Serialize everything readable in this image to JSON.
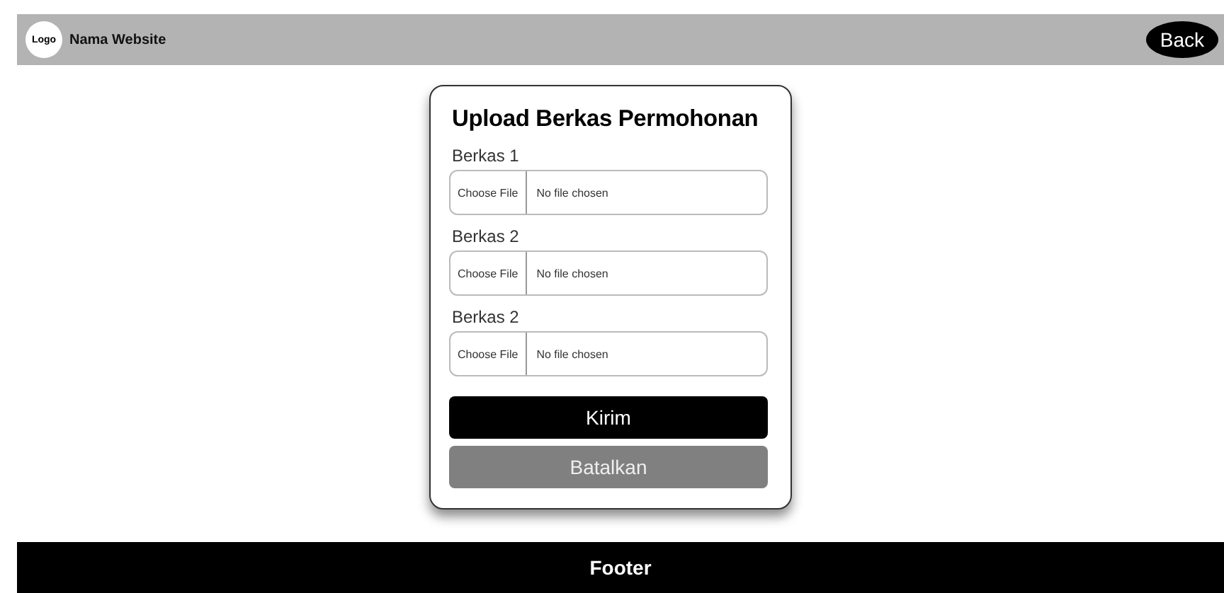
{
  "header": {
    "logo": "Logo",
    "site_name": "Nama Website",
    "back_button": "Back"
  },
  "card": {
    "title": "Upload Berkas Permohonan",
    "fields": [
      {
        "label": "Berkas 1",
        "button": "Choose File",
        "status": "No file chosen"
      },
      {
        "label": "Berkas 2",
        "button": "Choose File",
        "status": "No file chosen"
      },
      {
        "label": "Berkas 2",
        "button": "Choose File",
        "status": "No file chosen"
      }
    ],
    "buttons": [
      {
        "label": "Kirim",
        "kind": "primary"
      },
      {
        "label": "Batalkan",
        "kind": "secondary"
      }
    ]
  },
  "footer": {
    "text": "Footer"
  }
}
